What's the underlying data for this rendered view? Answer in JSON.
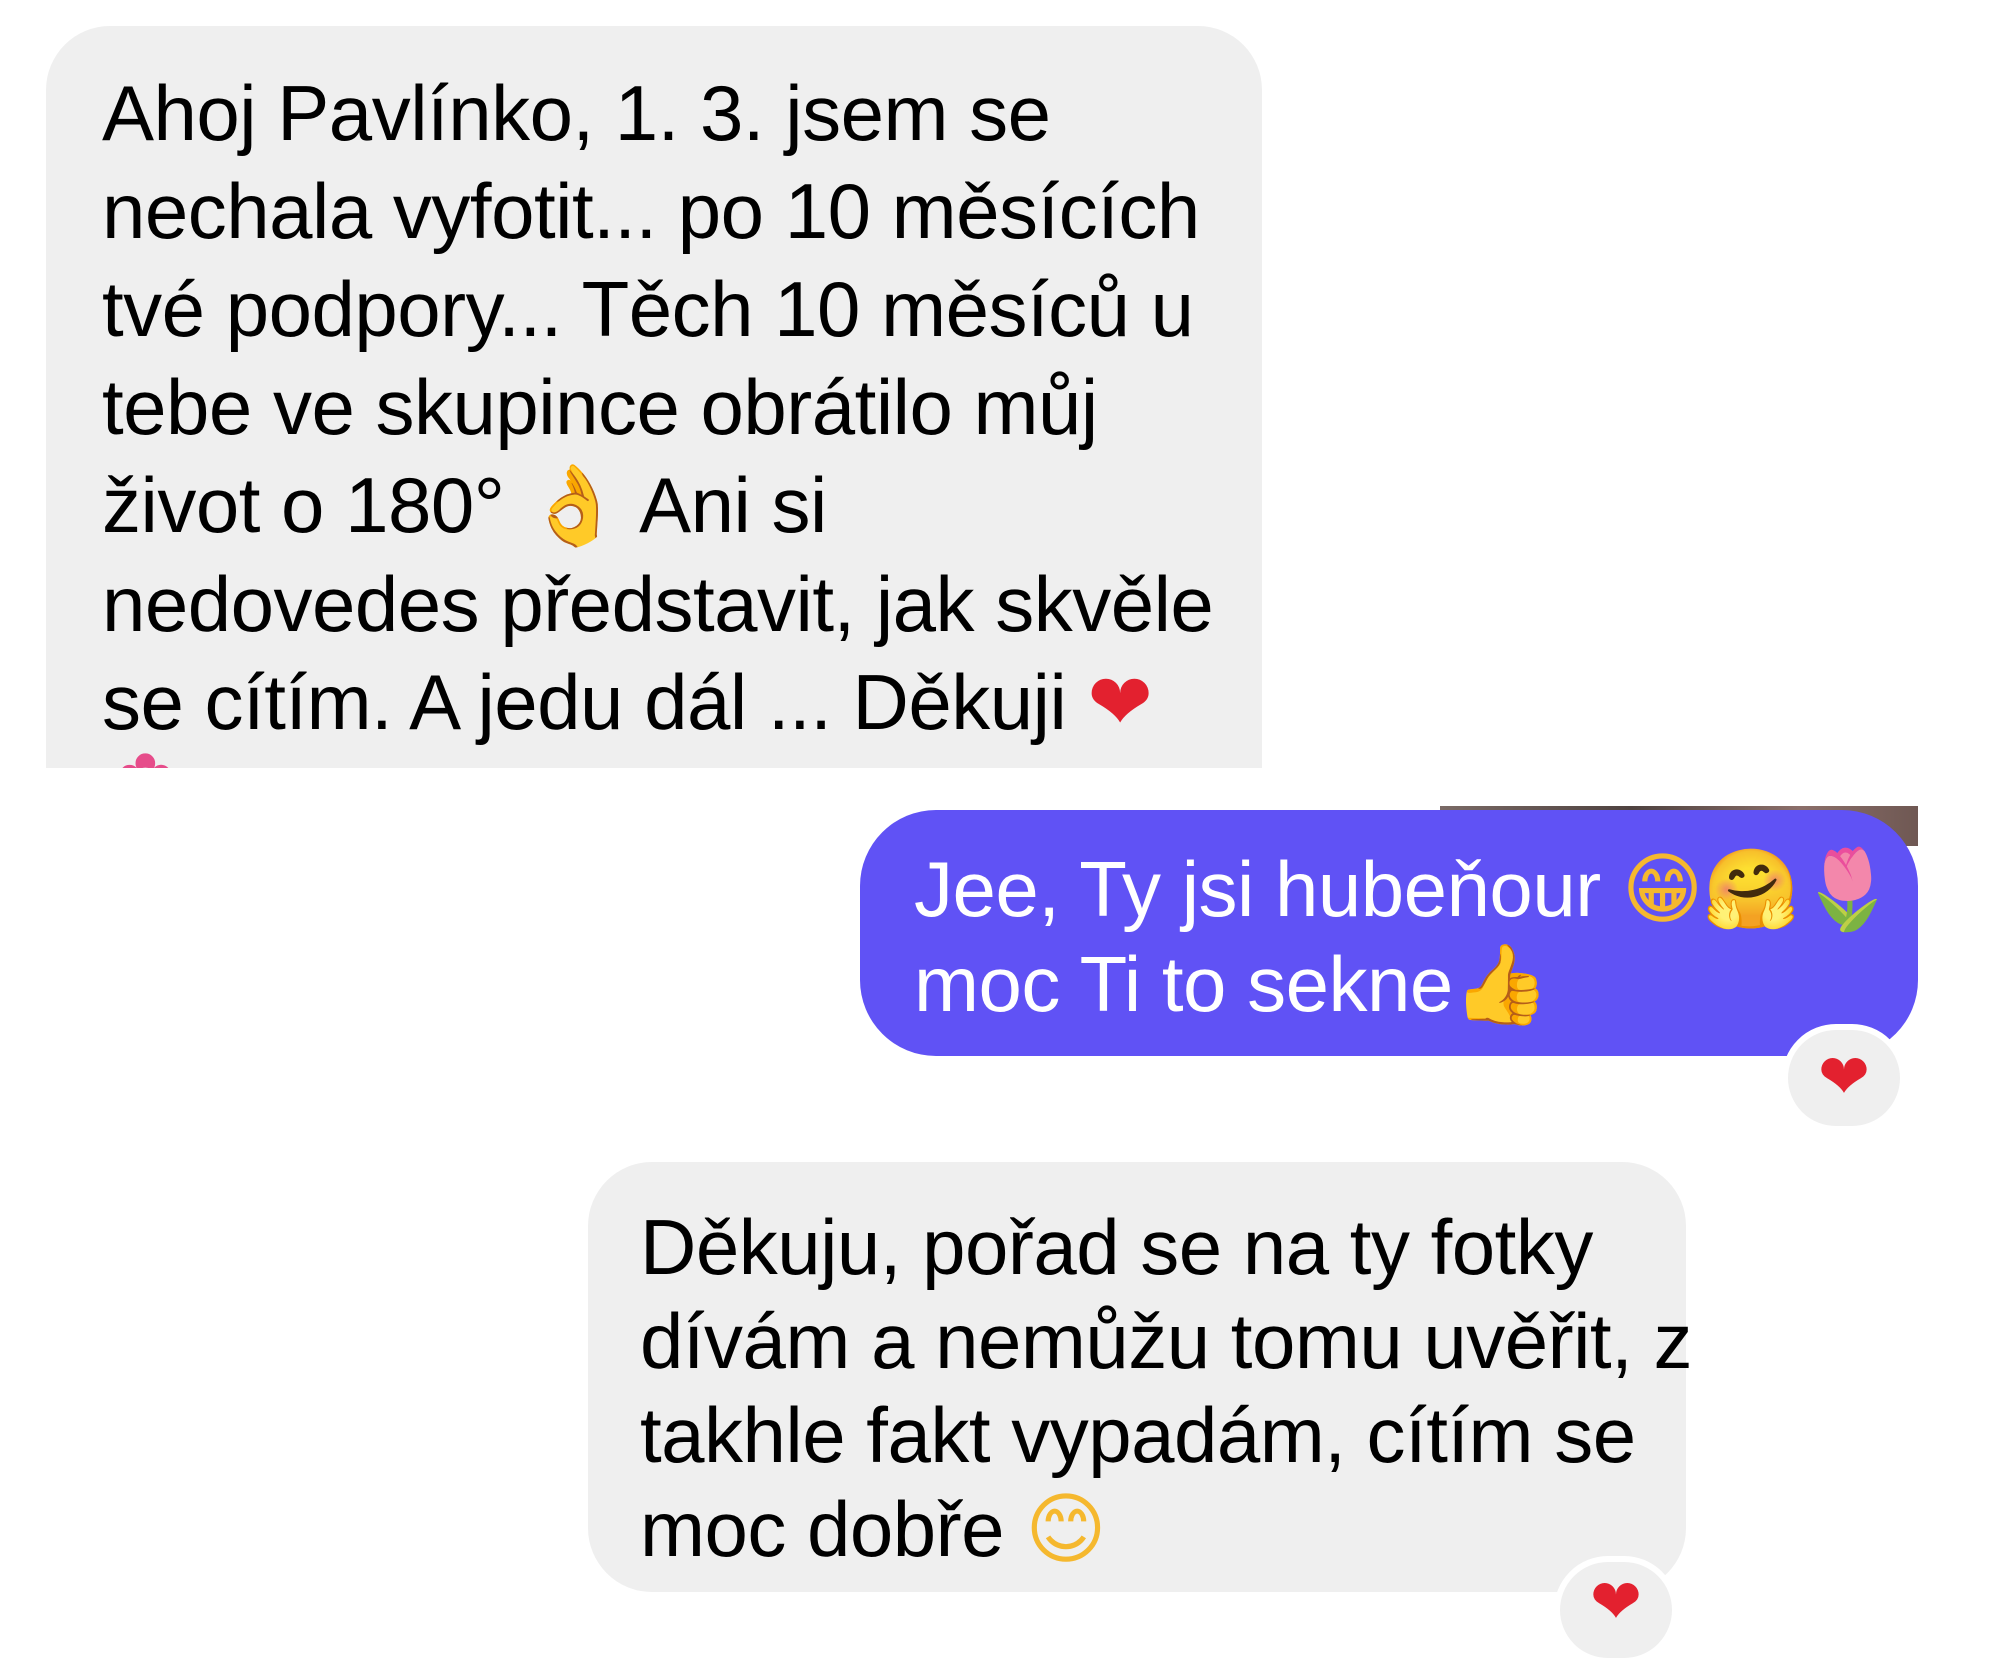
{
  "messages": [
    {
      "direction": "incoming",
      "lines": [
        "Ahoj Pavlínko, 1. 3. jsem se",
        "nechala vyfotit... po 10 měsících",
        "tvé podpory... Těch 10 měsíců u",
        "tebe ve skupince obrátilo můj",
        "život o 180°",
        "Ani si",
        "nedovedes představit, jak skvěle",
        "se cítím. A jedu dál ... Děkuji"
      ],
      "emojis": [
        "ok-hand-emoji",
        "red-heart-emoji",
        "flower-emoji"
      ]
    },
    {
      "direction": "outgoing",
      "lines": [
        "Jee, Ty jsi hubeňour",
        "moc Ti to sekne"
      ],
      "emojis": [
        "grinning-emoji",
        "hugging-emoji",
        "tulip-emoji",
        "thumbs-up-emoji"
      ],
      "reaction": "red-heart-emoji"
    },
    {
      "direction": "incoming",
      "lines": [
        "Děkuju, pořad se na ty fotky",
        "dívám a nemůžu tomu uvěřit, z",
        "takhle fakt vypadám, cítím se",
        "moc dobře"
      ],
      "emojis": [
        "smiling-emoji"
      ],
      "reaction": "red-heart-emoji"
    }
  ],
  "colors": {
    "incoming_bubble": "#efefef",
    "outgoing_bubble": "#6052f5",
    "incoming_text": "#000000",
    "outgoing_text": "#ffffff",
    "heart": "#e3212f"
  }
}
